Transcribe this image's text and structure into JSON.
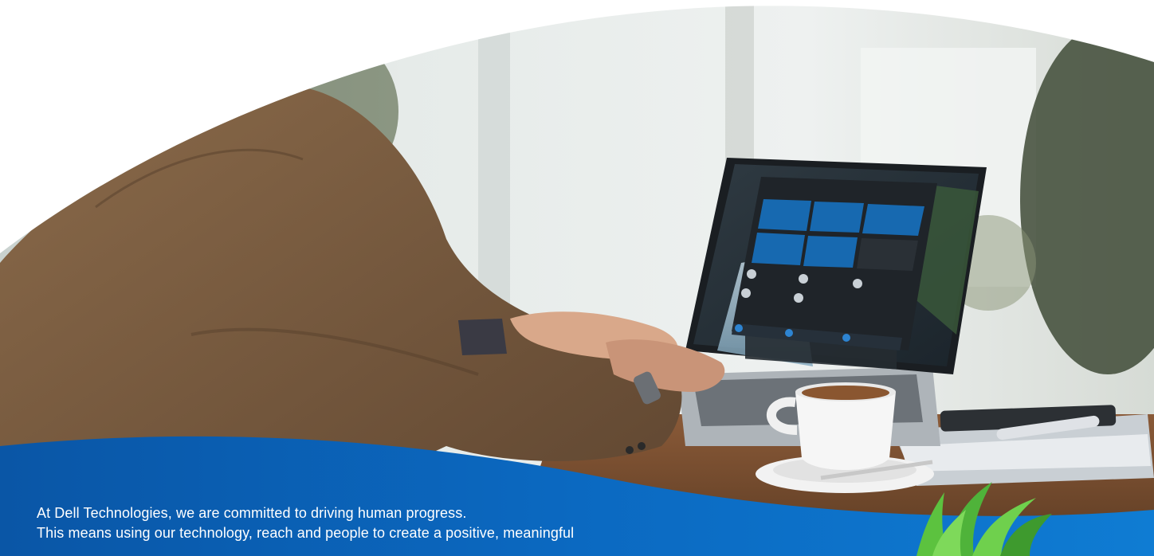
{
  "hero": {
    "text_lines": [
      "At Dell Technologies, we are committed to driving human progress.",
      "This means using our technology, reach and people to create a positive, meaningful"
    ]
  },
  "laptop_screen": {
    "tiles": [
      {
        "icon": "applications-icon"
      },
      {
        "icon": "audio-icon"
      },
      {
        "icon": "collaboration-icon"
      },
      {
        "icon": "network-icon"
      },
      {
        "icon": "power-icon"
      },
      {
        "icon": "presence-detection-icon"
      }
    ]
  },
  "colors": {
    "brand_blue": "#0672cb",
    "brand_blue_dark": "#0b4f9a",
    "tile_blue": "#1769b0",
    "grass_green": "#4fb33a"
  }
}
